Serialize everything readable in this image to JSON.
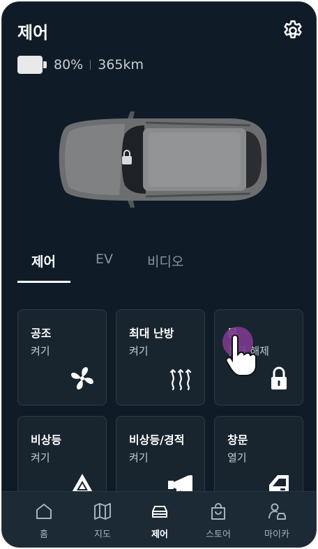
{
  "header": {
    "title": "제어",
    "settings_icon": "gear-icon"
  },
  "status": {
    "battery_level": 0.8,
    "battery_percent": "80%",
    "range": "365km"
  },
  "tabs": [
    {
      "label": "제어",
      "active": true
    },
    {
      "label": "EV",
      "active": false
    },
    {
      "label": "비디오",
      "active": false
    }
  ],
  "cards": [
    {
      "title": "공조",
      "action": "켜기",
      "icon": "fan-icon"
    },
    {
      "title": "최대 난방",
      "action": "켜기",
      "icon": "heat-waves-icon"
    },
    {
      "title": "문",
      "action": "잠금 해제",
      "icon": "lock-icon"
    },
    {
      "title": "비상등",
      "action": "켜기",
      "icon": "hazard-triangle-icon"
    },
    {
      "title": "비상등/경적",
      "action": "켜기",
      "icon": "horn-icon"
    },
    {
      "title": "창문",
      "action": "열기",
      "icon": "window-icon"
    }
  ],
  "bottom_nav": [
    {
      "label": "홈",
      "icon": "home-icon",
      "active": false
    },
    {
      "label": "지도",
      "icon": "map-icon",
      "active": false
    },
    {
      "label": "제어",
      "icon": "car-icon",
      "active": true
    },
    {
      "label": "스토어",
      "icon": "shopping-bag-icon",
      "active": false
    },
    {
      "label": "마이카",
      "icon": "user-car-icon",
      "active": false
    }
  ],
  "colors": {
    "background": "#0f1c27",
    "card": "#18252f",
    "nav": "#1c2a35",
    "touch_indicator": "#7c3a8c"
  }
}
